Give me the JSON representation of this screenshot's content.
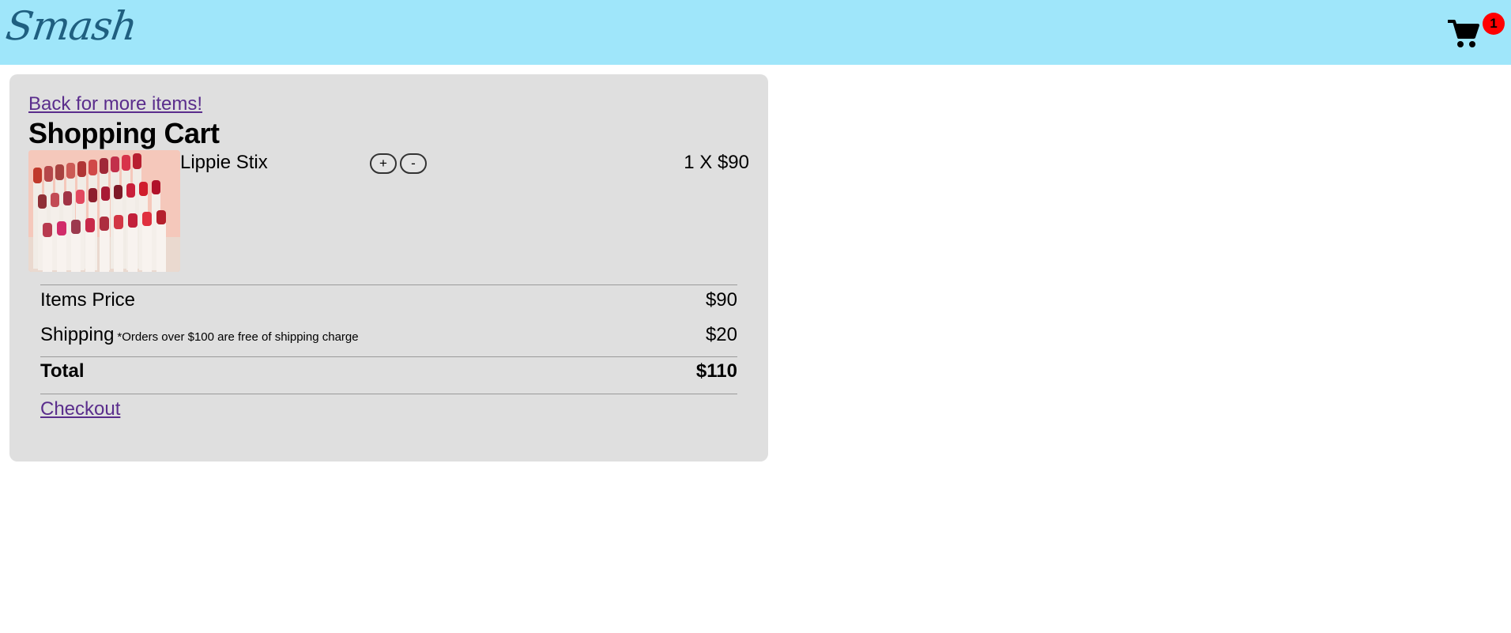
{
  "header": {
    "logo_text": "Smash",
    "cart_badge_count": "1",
    "cart_icon": "shopping-cart-icon"
  },
  "cart": {
    "back_link": "Back for more items!",
    "title": "Shopping Cart",
    "items": [
      {
        "name": "Lippie Stix",
        "plus_label": "+",
        "minus_label": "-",
        "unit_price_text": "1 X $90",
        "image": "lipstick-collection-image"
      }
    ],
    "summary": {
      "items_price_label": "Items Price",
      "items_price_value": "$90",
      "shipping_label": "Shipping",
      "shipping_note": "*Orders over $100 are free of shipping charge",
      "shipping_value": "$20",
      "total_label": "Total",
      "total_value": "$110"
    },
    "checkout_label": "Checkout"
  },
  "colors": {
    "header_bg": "#9fe6fa",
    "panel_bg": "#dfdfdf",
    "link": "#5a2d8c",
    "badge": "#ff0000",
    "logo": "#1f5f80"
  }
}
